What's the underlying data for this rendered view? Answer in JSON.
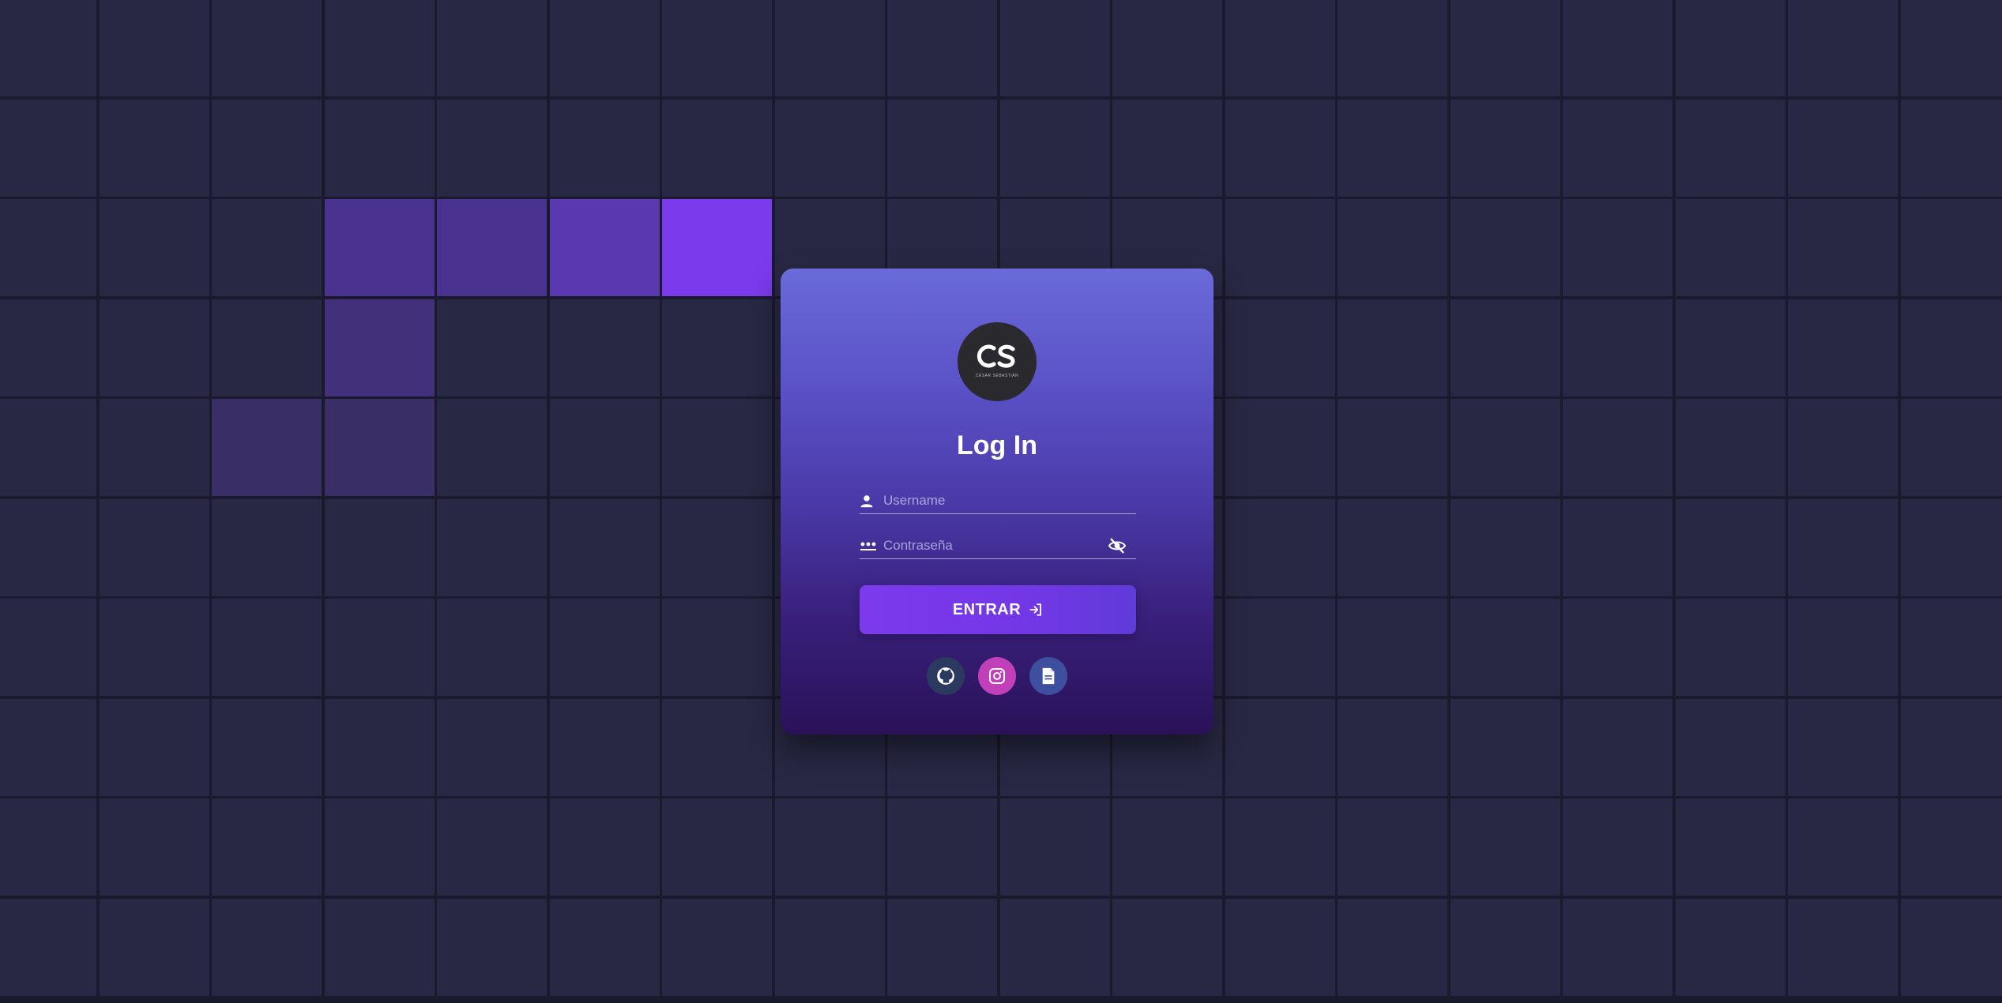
{
  "login": {
    "title": "Log In",
    "logo_text": "CS",
    "logo_subtext": "CÉSAR SEBASTIÁN",
    "username_placeholder": "Username",
    "password_placeholder": "Contraseña",
    "submit_label": "ENTRAR"
  },
  "social_links": [
    {
      "name": "github",
      "icon": "github-icon",
      "color": "#2b3a5e"
    },
    {
      "name": "instagram",
      "icon": "instagram-icon",
      "color": "#c13fb8"
    },
    {
      "name": "document",
      "icon": "document-icon",
      "color": "#3f4fa0"
    }
  ],
  "colors": {
    "background": "#1a1a2e",
    "grid_cell": "#282844",
    "accent": "#7c3aed",
    "card_top": "#6a6ad8",
    "card_bottom": "#2a1158"
  }
}
